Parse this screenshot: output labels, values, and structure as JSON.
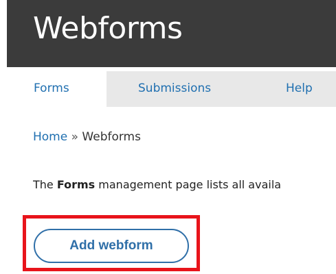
{
  "header": {
    "title": "Webforms"
  },
  "tabs": [
    {
      "label": "Forms",
      "active": true
    },
    {
      "label": "Submissions",
      "active": false
    },
    {
      "label": "Help",
      "active": false
    }
  ],
  "breadcrumb": {
    "home": "Home",
    "separator": "»",
    "current": "Webforms"
  },
  "description": {
    "prefix": "The ",
    "bold": "Forms",
    "suffix": " management page lists all availa"
  },
  "actions": {
    "add_webform_label": "Add webform"
  },
  "colors": {
    "header_bg": "#3b3b3b",
    "link": "#1f6fb0",
    "tab_bar_bg": "#e8e8e8",
    "highlight": "#e8141b",
    "button_border": "#2f6fa8"
  }
}
